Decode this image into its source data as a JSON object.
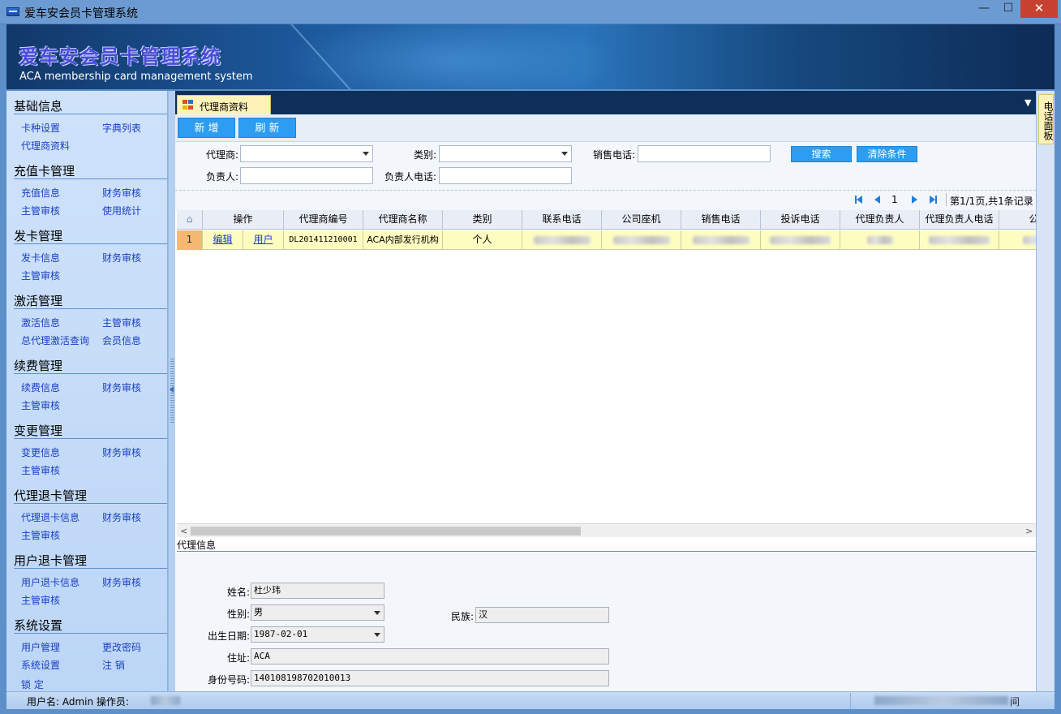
{
  "window": {
    "title": "爱车安会员卡管理系统",
    "minimize": "—",
    "maximize": "☐",
    "close": "✕"
  },
  "banner": {
    "title_cn": "爱车安会员卡管理系统",
    "title_en": "ACA membership card management system"
  },
  "sidebar": {
    "groups": [
      {
        "title": "基础信息",
        "items": [
          "卡种设置",
          "字典列表",
          "代理商资料"
        ]
      },
      {
        "title": "充值卡管理",
        "items": [
          "充值信息",
          "财务审核",
          "主管审核",
          "使用统计"
        ]
      },
      {
        "title": "发卡管理",
        "items": [
          "发卡信息",
          "财务审核",
          "主管审核"
        ]
      },
      {
        "title": "激活管理",
        "items": [
          "激活信息",
          "主管审核",
          "总代理激活查询",
          "会员信息"
        ]
      },
      {
        "title": "续费管理",
        "items": [
          "续费信息",
          "财务审核",
          "主管审核"
        ]
      },
      {
        "title": "变更管理",
        "items": [
          "变更信息",
          "财务审核",
          "主管审核"
        ]
      },
      {
        "title": "代理退卡管理",
        "items": [
          "代理退卡信息",
          "财务审核",
          "主管审核"
        ]
      },
      {
        "title": "用户退卡管理",
        "items": [
          "用户退卡信息",
          "财务审核",
          "主管审核"
        ]
      },
      {
        "title": "系统设置",
        "items": [
          "用户管理",
          "更改密码",
          "系统设置",
          "注  销",
          "锁  定"
        ]
      }
    ]
  },
  "tabs": [
    {
      "label": "代理商资料",
      "active": true
    }
  ],
  "toolbar": {
    "new_label": "新 增",
    "refresh_label": "刷 新"
  },
  "filters": {
    "agent_label": "代理商:",
    "agent_value": "",
    "category_label": "类别:",
    "category_value": "",
    "sales_phone_label": "销售电话:",
    "sales_phone_value": "",
    "owner_label": "负责人:",
    "owner_value": "",
    "owner_phone_label": "负责人电话:",
    "owner_phone_value": "",
    "search_label": "搜索",
    "clear_label": "清除条件"
  },
  "pager": {
    "page": "1",
    "summary": "第1/1页,共1条记录"
  },
  "grid": {
    "columns": [
      "操作",
      "代理商编号",
      "代理商名称",
      "类别",
      "联系电话",
      "公司座机",
      "销售电话",
      "投诉电话",
      "代理负责人",
      "代理负责人电话",
      "公司"
    ],
    "rows": [
      {
        "index": "1",
        "edit": "编辑",
        "users": "用户",
        "agent_no": "DL201411210001",
        "agent_name": "ACA内部发行机构",
        "category": "个人"
      }
    ]
  },
  "info": {
    "title": "代理信息",
    "name_label": "姓名:",
    "name_value": "杜少玮",
    "gender_label": "性别:",
    "gender_value": "男",
    "ethnicity_label": "民族:",
    "ethnicity_value": "汉",
    "birth_label": "出生日期:",
    "birth_value": "1987-02-01",
    "address_label": "住址:",
    "address_value": "ACA",
    "id_label": "身份号码:",
    "id_value": "140108198702010013"
  },
  "right_panel": {
    "tab_label": "电话面板"
  },
  "status": {
    "user_text": "用户名: Admin   操作员:",
    "tail": "间"
  },
  "colors": {
    "accent": "#2c9df0",
    "link": "#1a3fc2",
    "row_highlight": "#fefdc0",
    "tab_active": "#fdf2b8"
  }
}
